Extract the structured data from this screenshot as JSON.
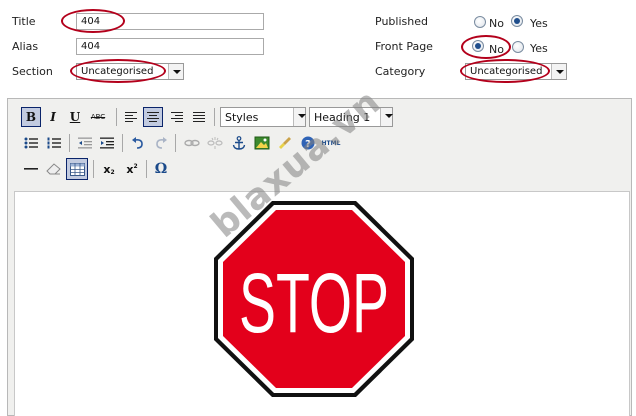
{
  "form": {
    "title_label": "Title",
    "title_value": "404",
    "alias_label": "Alias",
    "alias_value": "404",
    "section_label": "Section",
    "section_value": "Uncategorised",
    "published_label": "Published",
    "published_no": "No",
    "published_yes": "Yes",
    "published_selected": "Yes",
    "frontpage_label": "Front Page",
    "frontpage_no": "No",
    "frontpage_yes": "Yes",
    "frontpage_selected": "No",
    "category_label": "Category",
    "category_value": "Uncategorised"
  },
  "toolbar": {
    "bold": "B",
    "italic": "I",
    "underline": "U",
    "strike": "ABC",
    "styles_value": "Styles",
    "format_value": "Heading 1",
    "html_label": "HTML",
    "subscript": "x",
    "superscript": "x",
    "omega": "Ω"
  },
  "content": {
    "stop_sign_text": "STOP"
  },
  "watermark": "blaxua.vn",
  "colors": {
    "highlight_ellipse": "#b3001b",
    "stop_red": "#e3001b"
  }
}
